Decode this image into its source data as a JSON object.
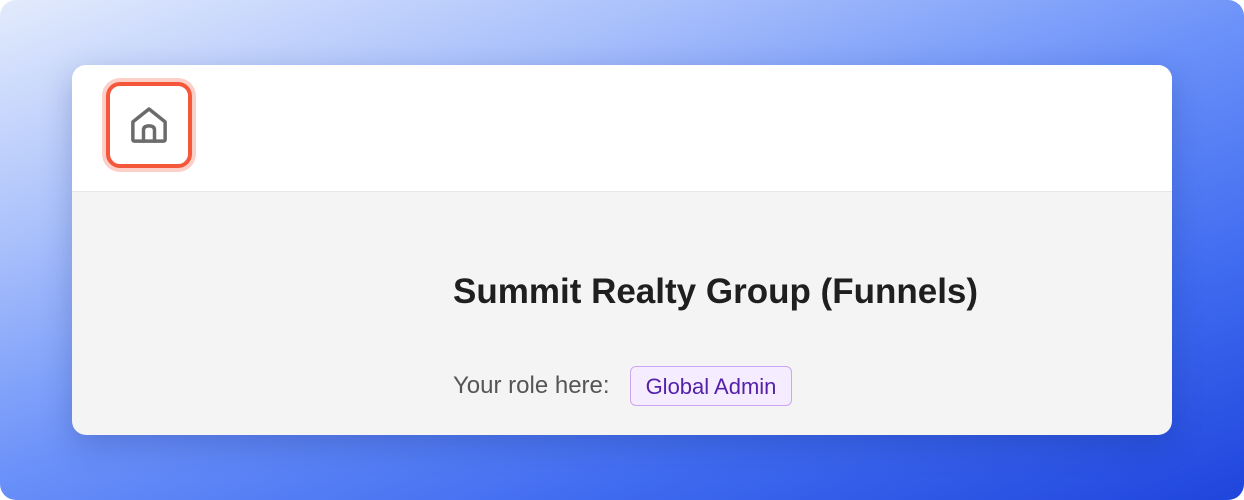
{
  "header": {
    "home_icon": "home-icon"
  },
  "organization": {
    "name": "Summit Realty Group (Funnels)"
  },
  "role": {
    "label": "Your role here:",
    "value": "Global Admin"
  },
  "colors": {
    "highlight": "#f4573a",
    "badge_text": "#5421a8",
    "badge_background": "#f6ecff",
    "badge_border": "#cda6f2"
  }
}
